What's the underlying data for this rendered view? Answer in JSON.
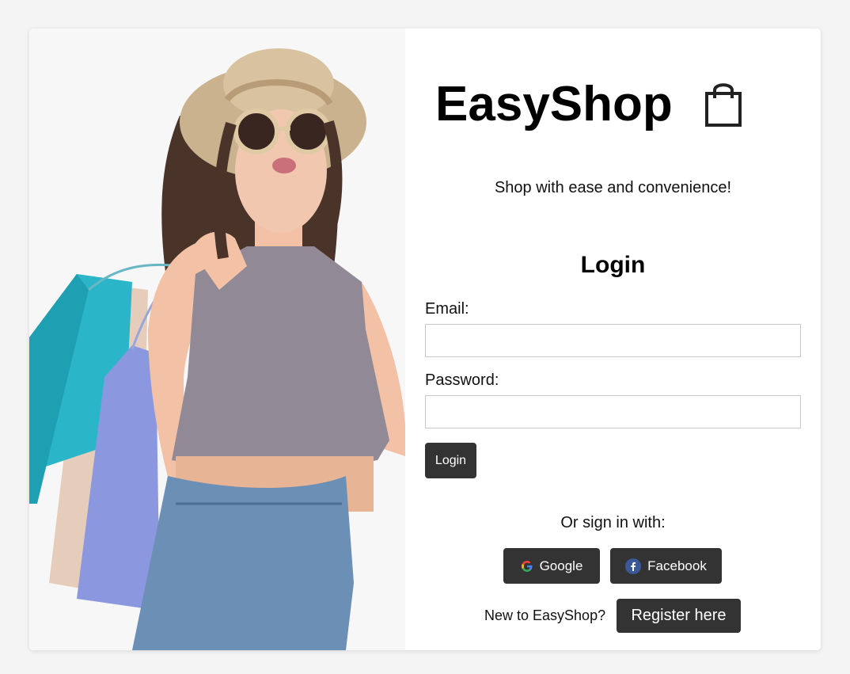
{
  "brand": {
    "name": "EasyShop",
    "tagline": "Shop with ease and convenience!"
  },
  "icons": {
    "brand": "shopping-bag-icon",
    "google": "google-icon",
    "facebook": "facebook-icon"
  },
  "login": {
    "heading": "Login",
    "email_label": "Email:",
    "email_value": "",
    "password_label": "Password:",
    "password_value": "",
    "submit_label": "Login"
  },
  "social": {
    "prompt": "Or sign in with:",
    "google_label": "Google",
    "facebook_label": "Facebook"
  },
  "register": {
    "prompt": "New to EasyShop?",
    "button_label": "Register here"
  },
  "colors": {
    "page_background": "#f4f4f4",
    "card_background": "#ffffff",
    "button_dark": "#333333",
    "facebook_blue": "#3b5998"
  }
}
